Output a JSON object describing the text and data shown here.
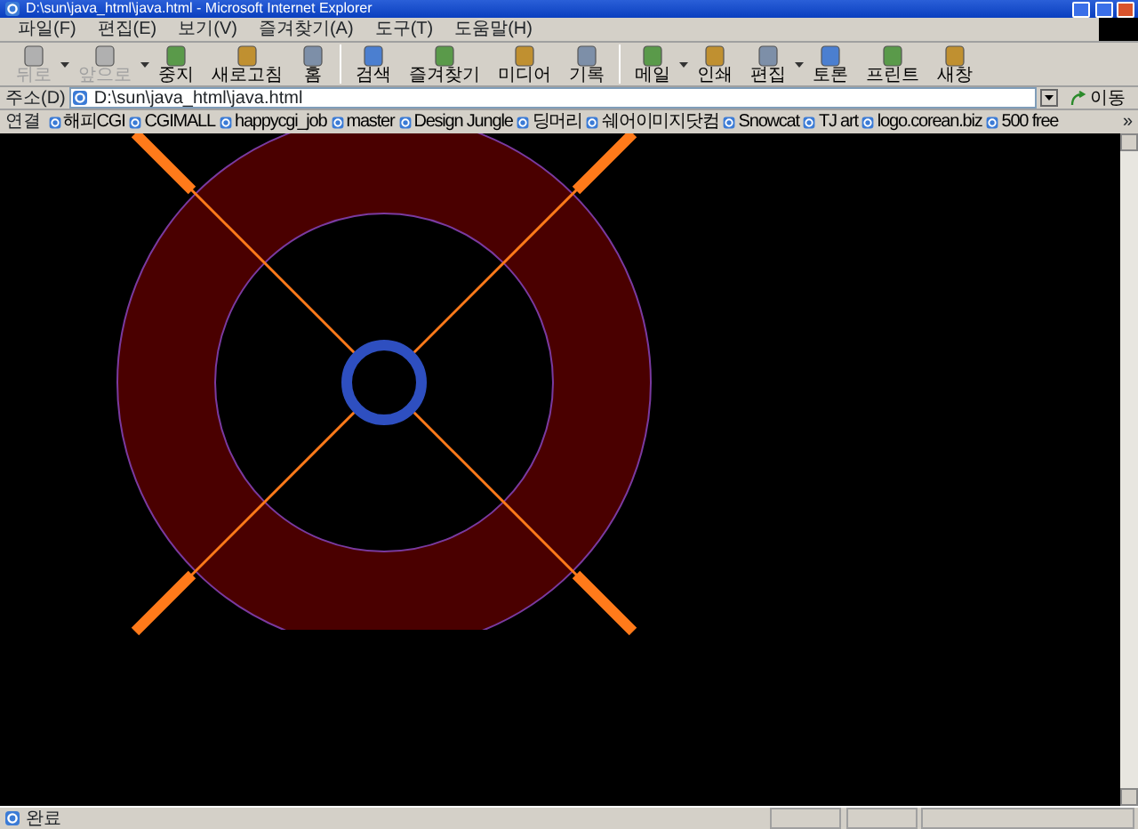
{
  "window": {
    "title": "D:\\sun\\java_html\\java.html - Microsoft Internet Explorer"
  },
  "menu": [
    "파일(F)",
    "편집(E)",
    "보기(V)",
    "즐겨찾기(A)",
    "도구(T)",
    "도움말(H)"
  ],
  "toolbar": [
    [
      {
        "label": "뒤로",
        "disabled": true,
        "dropdown": true
      },
      {
        "label": "앞으로",
        "disabled": true,
        "dropdown": true
      },
      {
        "label": "중지",
        "disabled": false,
        "dropdown": false
      },
      {
        "label": "새로고침",
        "disabled": false,
        "dropdown": false
      },
      {
        "label": "홈",
        "disabled": false,
        "dropdown": false
      }
    ],
    [
      {
        "label": "검색",
        "disabled": false,
        "dropdown": false
      },
      {
        "label": "즐겨찾기",
        "disabled": false,
        "dropdown": false
      },
      {
        "label": "미디어",
        "disabled": false,
        "dropdown": false
      },
      {
        "label": "기록",
        "disabled": false,
        "dropdown": false
      }
    ],
    [
      {
        "label": "메일",
        "disabled": false,
        "dropdown": true
      },
      {
        "label": "인쇄",
        "disabled": false,
        "dropdown": false
      },
      {
        "label": "편집",
        "disabled": false,
        "dropdown": true
      },
      {
        "label": "토론",
        "disabled": false,
        "dropdown": false
      },
      {
        "label": "프린트",
        "disabled": false,
        "dropdown": false
      },
      {
        "label": "새창",
        "disabled": false,
        "dropdown": false
      }
    ]
  ],
  "address": {
    "label": "주소(D)",
    "value": "D:\\sun\\java_html\\java.html",
    "go": "이동"
  },
  "links": {
    "label": "연결",
    "items": [
      "해피CGI",
      "CGIMALL",
      "happycgi_job",
      "master",
      "Design Jungle",
      "딩머리",
      "쉐어이미지닷컴",
      "Snowcat",
      "TJ art",
      "logo.corean.biz",
      "500 free"
    ],
    "more": "»"
  },
  "status_bar": {
    "text": "완료"
  }
}
